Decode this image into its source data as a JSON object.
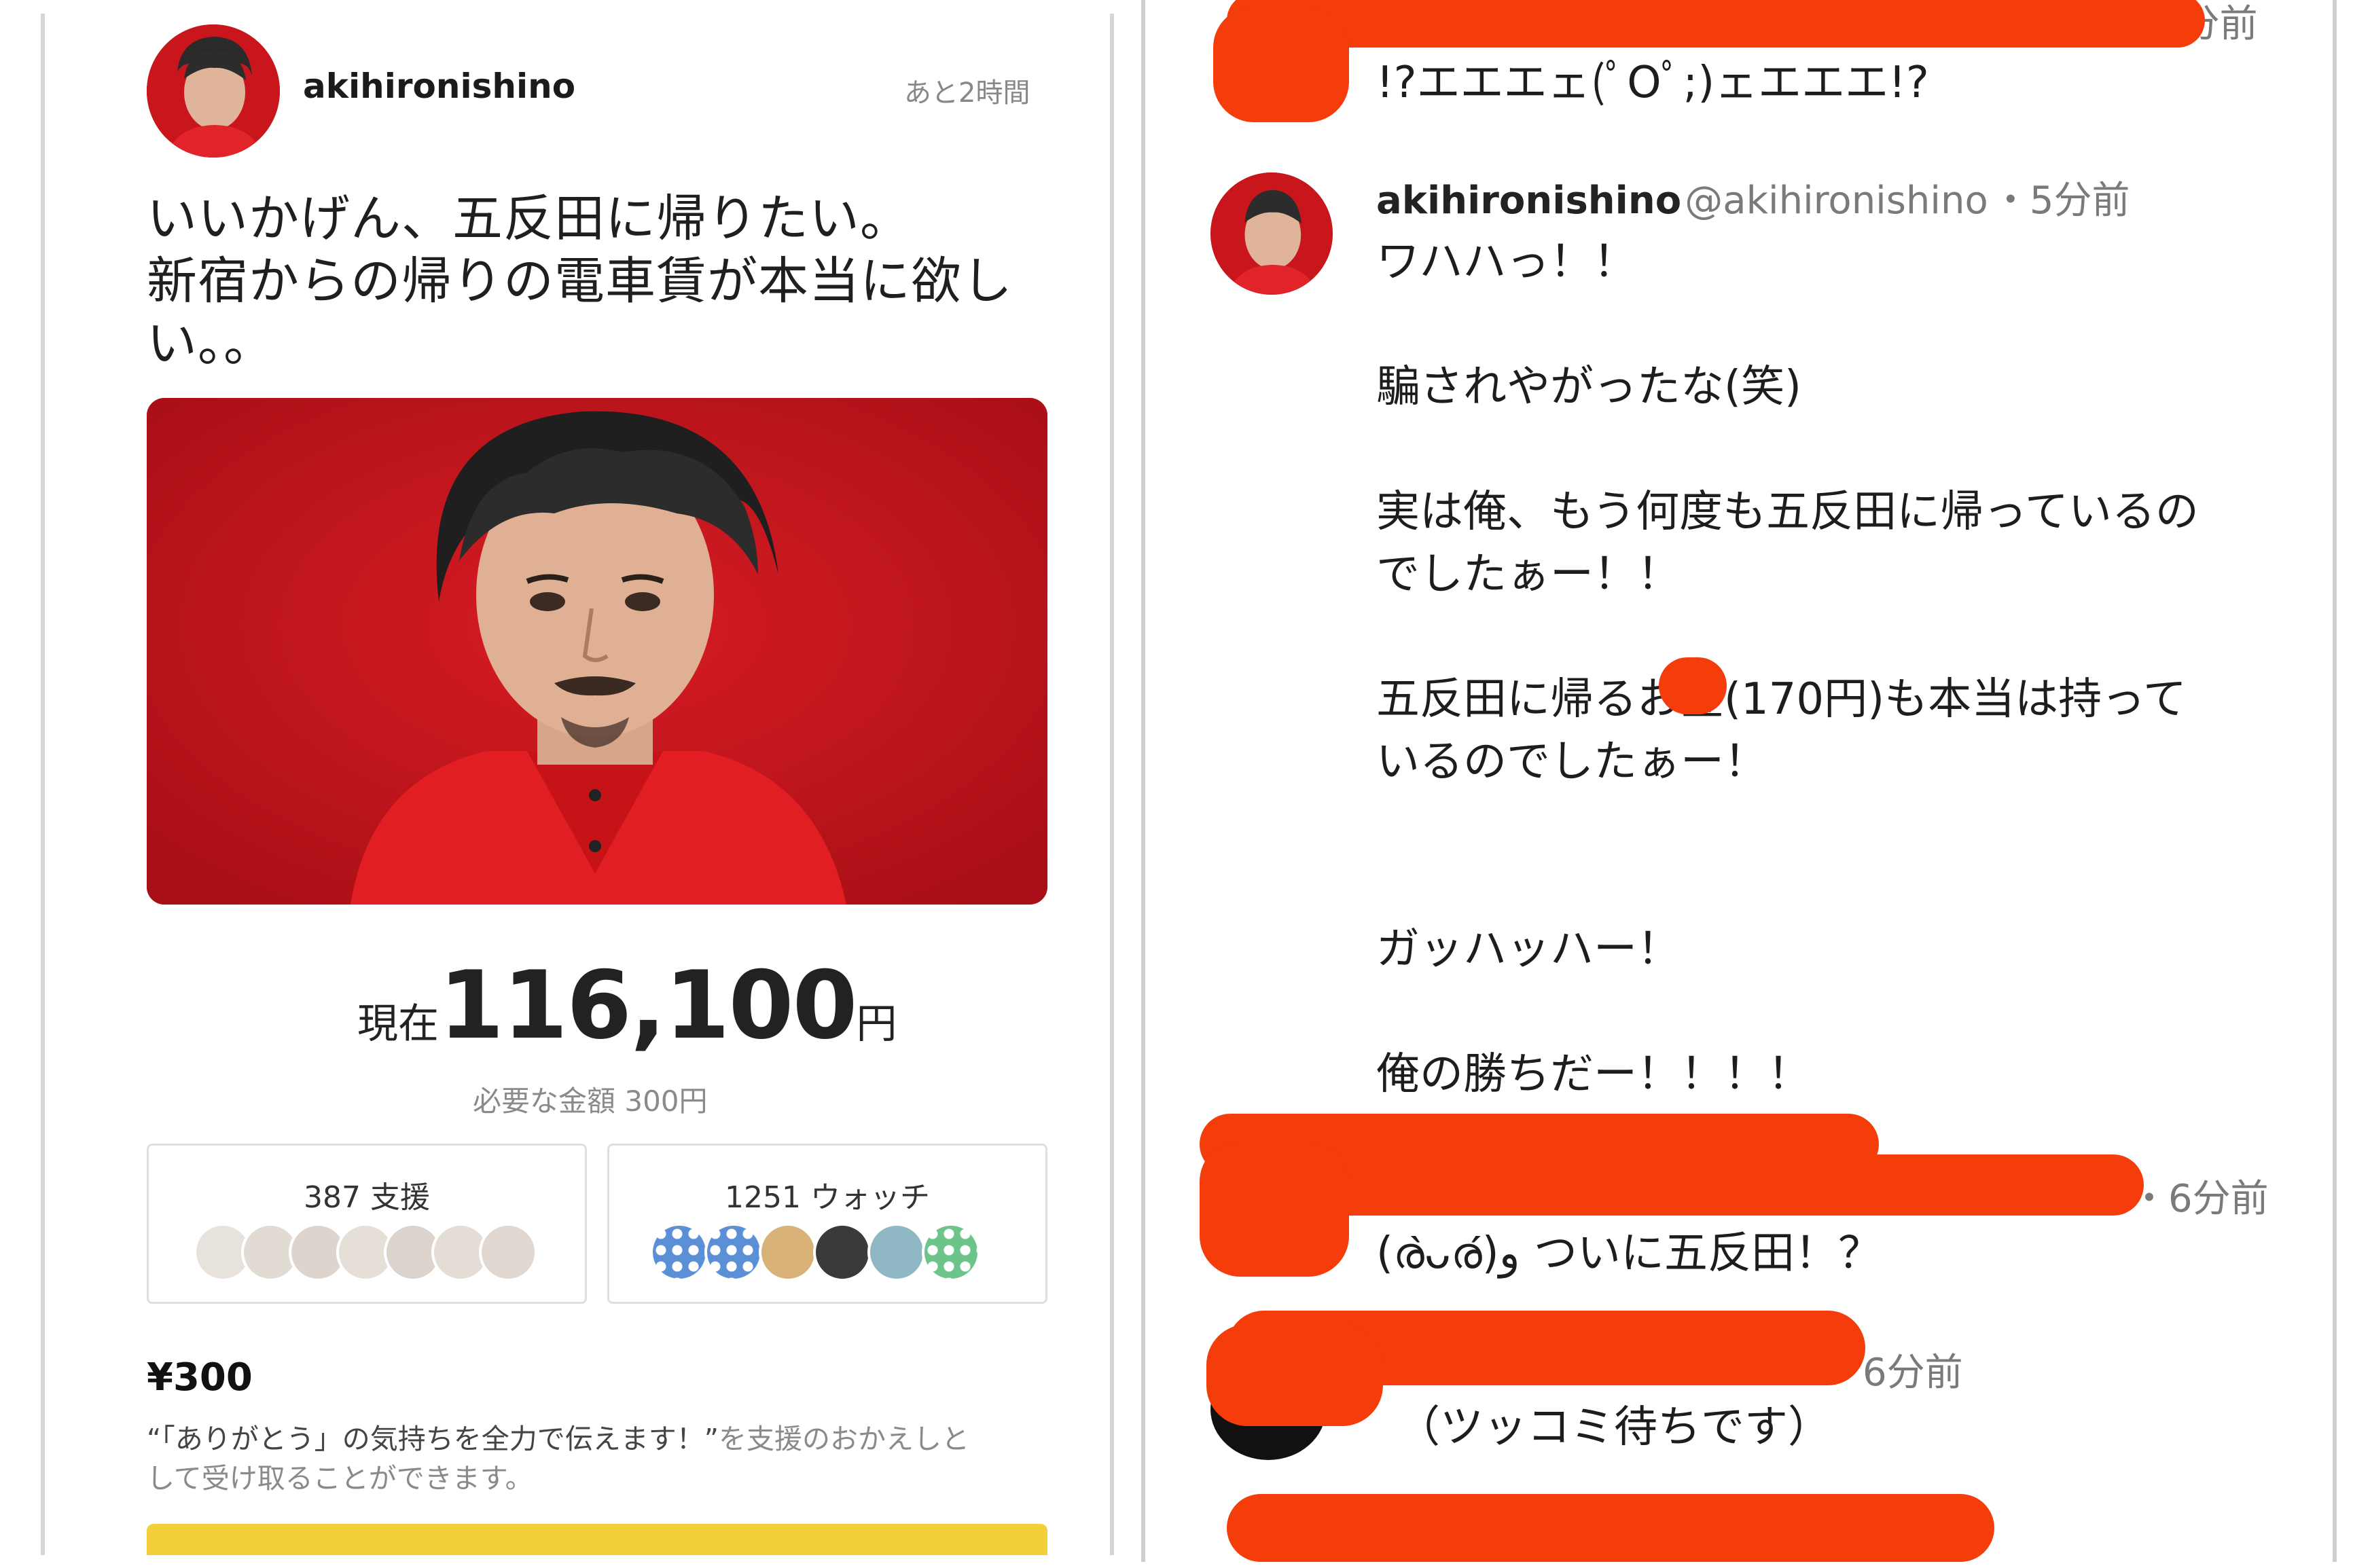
{
  "left": {
    "username": "akihironishino",
    "time_left": "あと2時間",
    "post_lines": [
      "いいかげん、五反田に帰りたい。",
      "新宿からの帰りの電車賃が本当に欲し",
      "い。。"
    ],
    "current_label": "現在",
    "current_amount": "116,100",
    "currency_suffix": "円",
    "needed": "必要な金額 300円",
    "supporters_label": "387 支援",
    "watchers_label": "1251 ウォッチ",
    "price": "¥300",
    "reward_quote": "“「ありがとう」の気持ちを全力で伝えます！”",
    "reward_rest": "を支援のおかえしと",
    "reward_line2": "して受け取ることができます。"
  },
  "right": {
    "top_reply_partial_time": "5分前",
    "top_reply_text": "!?エエエェ(ﾟOﾟ;)ェエエエ!?",
    "main_reply": {
      "name": "akihironishino",
      "handle": "@akihironishino",
      "time": "・5分前",
      "lines": [
        "ワハハっ！！",
        "",
        "騙されやがったな(笑)",
        "",
        "実は俺、もう何度も五反田に帰っているの",
        "でしたぁー！！",
        "",
        "五反田に帰るお金(170円)も本当は持って",
        "いるのでしたぁー！",
        "",
        "",
        "ガッハッハー！",
        "",
        "俺の勝ちだー！！！！"
      ]
    },
    "reply2": {
      "time": "・6分前",
      "text": "(ര̀ᴗര́)و ついに五反田！？"
    },
    "reply3": {
      "time": "・6分前",
      "text": "（ツッコミ待ちです）"
    }
  },
  "colors": {
    "redaction": "#f43d0a",
    "button_yellow": "#f3d03a",
    "photo_red": "#c4151c"
  }
}
